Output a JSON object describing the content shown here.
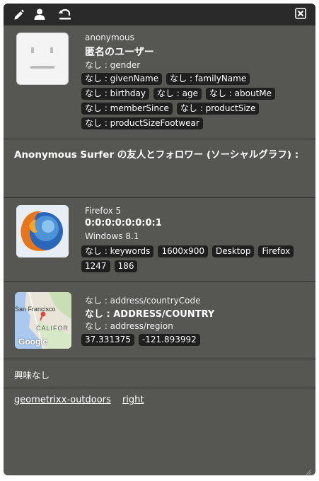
{
  "toolbar": {
    "icons": [
      "pencil-icon",
      "user-icon",
      "reset-icon",
      "close-icon"
    ]
  },
  "profile": {
    "name": "anonymous",
    "title": "匿名のユーザー",
    "gender": "なし : gender",
    "tags": [
      "なし : givenName",
      "なし : familyName",
      "なし : birthday",
      "なし : age",
      "なし : aboutMe",
      "なし : memberSince",
      "なし : productSize",
      "なし : productSizeFootwear"
    ]
  },
  "social": {
    "title": "Anonymous Surfer の友人とフォロワー (ソーシャルグラフ) :"
  },
  "browser": {
    "name": "Firefox 5",
    "ip": "0:0:0:0:0:0:0:1",
    "os": "Windows 8.1",
    "tags": [
      "なし : keywords",
      "1600x900",
      "Desktop",
      "Firefox",
      "1247",
      "186"
    ]
  },
  "geo": {
    "country_code": "なし : address/countryCode",
    "country": "なし : ADDRESS/COUNTRY",
    "region": "なし : address/region",
    "latitude": "37.331375",
    "longitude": "-121.893992",
    "map_labels": {
      "city": "San Francisco",
      "state": "CALIFOR",
      "brand": "Google"
    }
  },
  "interests": {
    "text": "興味なし"
  },
  "links": {
    "items": [
      "geometrixx-outdoors",
      "right"
    ]
  },
  "colors": {
    "panel": "#565753",
    "toolbar": "#2a2a2a",
    "tag": "#1f1f1f"
  }
}
